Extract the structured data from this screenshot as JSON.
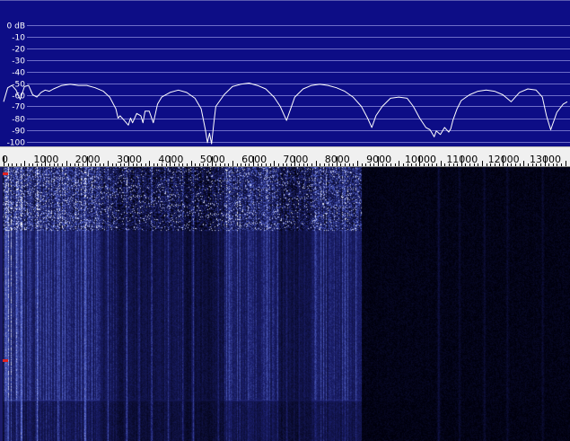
{
  "colors": {
    "spectrum_bg": "#0d0d86",
    "grid_line": "#6e6ec8",
    "trace": "#ffffff",
    "ruler_bg": "#f0f0f0",
    "waterfall_hot": "#ffffff",
    "waterfall_mid": "#5c6ed6",
    "waterfall_low": "#1a1e6a",
    "marker": "#e02020"
  },
  "chart_data": [
    {
      "type": "line",
      "title": "",
      "xlabel": "",
      "ylabel": "",
      "xlim": [
        0,
        13550
      ],
      "ylim": [
        -105,
        5
      ],
      "ylabel_unit": "dB",
      "y_ticks": [
        {
          "value": 0,
          "label": "0 dB"
        },
        {
          "value": -10,
          "label": "-10"
        },
        {
          "value": -20,
          "label": "-20"
        },
        {
          "value": -30,
          "label": "-30"
        },
        {
          "value": -40,
          "label": "-40"
        },
        {
          "value": -50,
          "label": "-50"
        },
        {
          "value": -60,
          "label": "-60"
        },
        {
          "value": -70,
          "label": "-70"
        },
        {
          "value": -80,
          "label": "-80"
        },
        {
          "value": -90,
          "label": "-90"
        },
        {
          "value": -100,
          "label": "-100"
        }
      ],
      "grid": true,
      "series": [
        {
          "x": [
            0,
            100,
            200,
            300,
            400,
            500,
            600,
            700,
            800,
            900,
            1000,
            1100,
            1200,
            1400,
            1600,
            1800,
            2000,
            2200,
            2400,
            2550,
            2700,
            2750,
            2800,
            2900,
            3000,
            3050,
            3100,
            3200,
            3300,
            3350,
            3400,
            3500,
            3600,
            3650,
            3700,
            3800,
            4000,
            4200,
            4400,
            4600,
            4750,
            4850,
            4900,
            4950,
            5000,
            5050,
            5100,
            5300,
            5500,
            5700,
            5900,
            6100,
            6300,
            6500,
            6650,
            6800,
            6900,
            7000,
            7200,
            7400,
            7600,
            7800,
            8000,
            8200,
            8400,
            8600,
            8750,
            8850,
            8950,
            9100,
            9300,
            9500,
            9700,
            9850,
            10000,
            10150,
            10250,
            10350,
            10400,
            10500,
            10600,
            10700,
            10750,
            10800,
            10900,
            11000,
            11200,
            11400,
            11600,
            11800,
            12000,
            12200,
            12400,
            12600,
            12800,
            12950,
            13050,
            13150,
            13300,
            13450,
            13550
          ],
          "y": [
            -66,
            -54,
            -52,
            -56,
            -64,
            -53,
            -52,
            -60,
            -62,
            -58,
            -56,
            -57,
            -55,
            -52,
            -51,
            -52,
            -52,
            -54,
            -57,
            -62,
            -72,
            -80,
            -78,
            -82,
            -86,
            -80,
            -84,
            -76,
            -78,
            -84,
            -74,
            -74,
            -84,
            -76,
            -68,
            -62,
            -58,
            -56,
            -58,
            -63,
            -72,
            -90,
            -101,
            -93,
            -102,
            -85,
            -70,
            -60,
            -53,
            -51,
            -50,
            -52,
            -55,
            -62,
            -70,
            -82,
            -72,
            -62,
            -55,
            -52,
            -51,
            -52,
            -54,
            -57,
            -62,
            -70,
            -80,
            -88,
            -78,
            -70,
            -63,
            -62,
            -63,
            -70,
            -80,
            -88,
            -90,
            -96,
            -91,
            -94,
            -88,
            -92,
            -89,
            -82,
            -72,
            -65,
            -60,
            -57,
            -56,
            -57,
            -60,
            -66,
            -58,
            -55,
            -56,
            -62,
            -78,
            -90,
            -75,
            -68,
            -66
          ]
        }
      ]
    },
    {
      "type": "heatmap",
      "title": "",
      "xlabel": "",
      "ylabel": "",
      "xlim": [
        0,
        13550
      ],
      "x_ticks": [
        {
          "value": 0,
          "label": "0"
        },
        {
          "value": 1000,
          "label": "1000"
        },
        {
          "value": 2000,
          "label": "2000"
        },
        {
          "value": 3000,
          "label": "3000"
        },
        {
          "value": 4000,
          "label": "4000"
        },
        {
          "value": 5000,
          "label": "5000"
        },
        {
          "value": 6000,
          "label": "6000"
        },
        {
          "value": 7000,
          "label": "7000"
        },
        {
          "value": 8000,
          "label": "8000"
        },
        {
          "value": 9000,
          "label": "9000"
        },
        {
          "value": 10000,
          "label": "10000"
        },
        {
          "value": 11000,
          "label": "11000"
        },
        {
          "value": 12000,
          "label": "12000"
        },
        {
          "value": 13000,
          "label": "13000"
        }
      ],
      "minor_tick_step": 100,
      "bands": [
        {
          "from": 0,
          "to": 450,
          "intensity": 0.62
        },
        {
          "from": 450,
          "to": 800,
          "intensity": 0.5
        },
        {
          "from": 800,
          "to": 2300,
          "intensity": 0.55
        },
        {
          "from": 2300,
          "to": 2700,
          "intensity": 0.38
        },
        {
          "from": 2700,
          "to": 3700,
          "intensity": 0.3
        },
        {
          "from": 3700,
          "to": 4300,
          "intensity": 0.36
        },
        {
          "from": 4300,
          "to": 5300,
          "intensity": 0.26
        },
        {
          "from": 5300,
          "to": 6600,
          "intensity": 0.5
        },
        {
          "from": 6600,
          "to": 7400,
          "intensity": 0.3
        },
        {
          "from": 7400,
          "to": 8600,
          "intensity": 0.5
        },
        {
          "from": 8600,
          "to": 13550,
          "intensity": 0.06
        }
      ],
      "tones": [
        {
          "freq": 100,
          "intensity": 0.9
        },
        {
          "freq": 420,
          "intensity": 1.0
        },
        {
          "freq": 800,
          "intensity": 0.85
        },
        {
          "freq": 1300,
          "intensity": 0.8
        },
        {
          "freq": 1950,
          "intensity": 0.95
        },
        {
          "freq": 2500,
          "intensity": 0.7
        },
        {
          "freq": 2950,
          "intensity": 0.75
        },
        {
          "freq": 3250,
          "intensity": 0.6
        },
        {
          "freq": 3550,
          "intensity": 0.7
        },
        {
          "freq": 3950,
          "intensity": 0.6
        },
        {
          "freq": 4300,
          "intensity": 0.6
        },
        {
          "freq": 4550,
          "intensity": 0.65
        },
        {
          "freq": 5150,
          "intensity": 0.55
        },
        {
          "freq": 5450,
          "intensity": 0.55
        },
        {
          "freq": 6800,
          "intensity": 0.5
        },
        {
          "freq": 7100,
          "intensity": 0.45
        },
        {
          "freq": 10450,
          "intensity": 0.28
        },
        {
          "freq": 10950,
          "intensity": 0.2
        },
        {
          "freq": 11550,
          "intensity": 0.22
        },
        {
          "freq": 12100,
          "intensity": 0.2
        },
        {
          "freq": 12950,
          "intensity": 0.2
        }
      ],
      "time_events": [
        {
          "row_fraction": 0.25,
          "intensity": 0.55
        },
        {
          "row_fraction": 0.85,
          "intensity": 0.7
        }
      ],
      "noisy_top_fraction": 0.23,
      "markers": [
        {
          "row_fraction": 0.02
        },
        {
          "row_fraction": 0.7
        }
      ]
    }
  ]
}
